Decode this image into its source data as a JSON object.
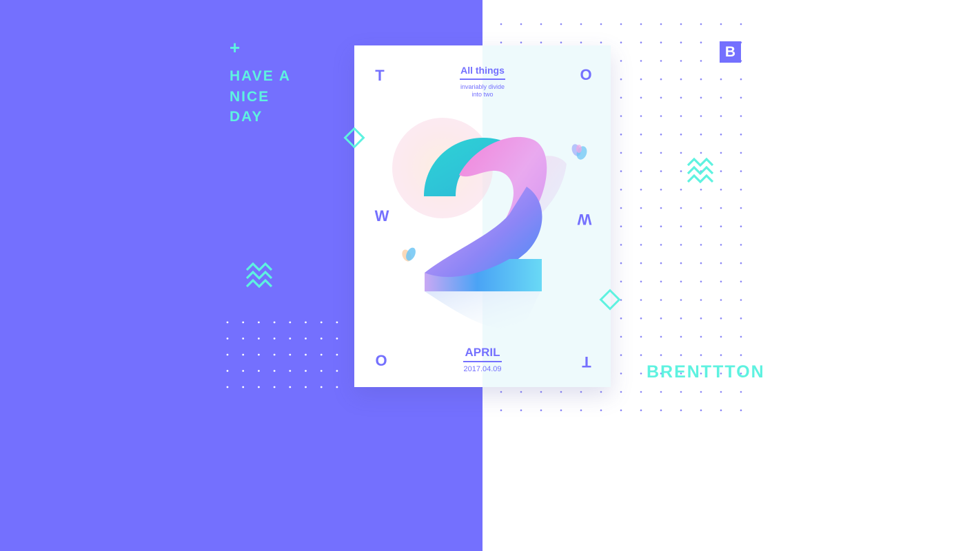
{
  "tagline": [
    "HAVE A",
    "NICE",
    "DAY"
  ],
  "plus_symbol": "+",
  "badge_letter": "B",
  "brand_name": "BRENTTTON",
  "poster": {
    "corner_letters": [
      "T",
      "O",
      "W",
      "W",
      "O",
      "T"
    ],
    "headline": "All things",
    "subline": [
      "invariably divide",
      "into two"
    ],
    "month": "APRIL",
    "date": "2017.04.09"
  },
  "colors": {
    "purple": "#7470fe",
    "mint": "#5ef2e0",
    "poster_tint": "#eefafc"
  },
  "icons": [
    "plus-icon",
    "zigzag-icon",
    "diamond-icon",
    "butterfly-icon"
  ]
}
